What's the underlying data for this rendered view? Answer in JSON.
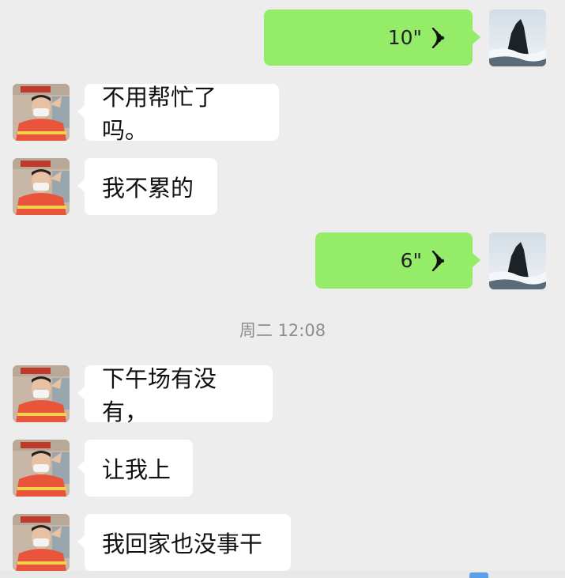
{
  "messages": [
    {
      "side": "out",
      "type": "voice",
      "duration": "10\""
    },
    {
      "side": "in",
      "type": "text",
      "text": "不用帮忙了吗。"
    },
    {
      "side": "in",
      "type": "text",
      "text": "我不累的"
    },
    {
      "side": "out",
      "type": "voice",
      "duration": "6\""
    },
    {
      "side": "in",
      "type": "text",
      "text": "下午场有没有，"
    },
    {
      "side": "in",
      "type": "text",
      "text": "让我上"
    },
    {
      "side": "in",
      "type": "text",
      "text": "我回家也没事干"
    }
  ],
  "timestamp": "周二 12:08",
  "icons": {
    "voice": "voice-wave-icon",
    "contact_avatar": "person-avatar",
    "self_avatar": "mountain-avatar"
  },
  "colors": {
    "background": "#ededed",
    "incoming_bubble": "#ffffff",
    "outgoing_bubble": "#95ec69",
    "timestamp_text": "#8d8d8d"
  }
}
